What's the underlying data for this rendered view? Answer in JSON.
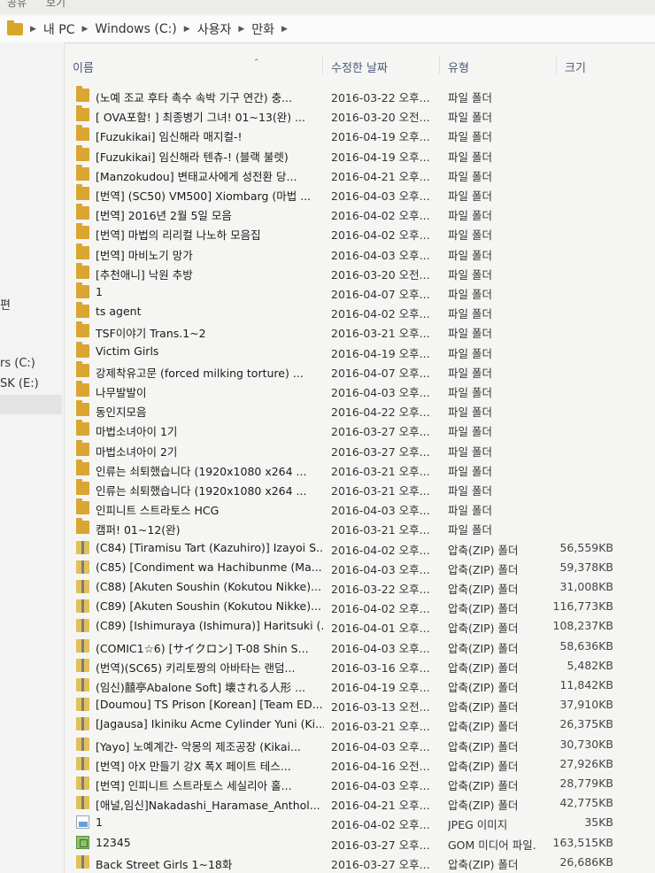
{
  "menu": {
    "items": [
      "공유",
      "보기"
    ]
  },
  "address": {
    "crumbs": [
      "내 PC",
      "Windows (C:)",
      "사용자",
      "만화"
    ]
  },
  "nav": {
    "partial_labels": [
      "편",
      "rs (C:)",
      "SK (E:)"
    ]
  },
  "columns": {
    "name": "이름",
    "date": "수정한 날짜",
    "type": "유형",
    "size": "크기"
  },
  "files": [
    {
      "icon": "folder",
      "name": "(노예 조교 후타 촉수 속박 기구 연간) 충...",
      "date": "2016-03-22 오후...",
      "type": "파일 폴더",
      "size": ""
    },
    {
      "icon": "folder",
      "name": "[ OVA포함! ] 최종병기 그녀! 01~13(완) ...",
      "date": "2016-03-20 오전...",
      "type": "파일 폴더",
      "size": ""
    },
    {
      "icon": "folder",
      "name": "[Fuzukikai] 임신해라 매지컬-!",
      "date": "2016-04-19 오후...",
      "type": "파일 폴더",
      "size": ""
    },
    {
      "icon": "folder",
      "name": "[Fuzukikai] 임신해라 텐츄-! (블랙 불렛)",
      "date": "2016-04-19 오후...",
      "type": "파일 폴더",
      "size": ""
    },
    {
      "icon": "folder",
      "name": "[Manzokudou] 변태교사에게 성전환 당...",
      "date": "2016-04-21 오후...",
      "type": "파일 폴더",
      "size": ""
    },
    {
      "icon": "folder",
      "name": "[번역] (SC50) VM500] Xiombarg (마법 ...",
      "date": "2016-04-03 오후...",
      "type": "파일 폴더",
      "size": ""
    },
    {
      "icon": "folder",
      "name": "[번역] 2016년 2월 5일 모음",
      "date": "2016-04-02 오후...",
      "type": "파일 폴더",
      "size": ""
    },
    {
      "icon": "folder",
      "name": "[번역] 마법의 리리컬 나노하 모음집",
      "date": "2016-04-02 오후...",
      "type": "파일 폴더",
      "size": ""
    },
    {
      "icon": "folder",
      "name": "[번역] 마비노기 망가",
      "date": "2016-04-03 오후...",
      "type": "파일 폴더",
      "size": ""
    },
    {
      "icon": "folder",
      "name": "[추천애니] 낙원 추방",
      "date": "2016-03-20 오전...",
      "type": "파일 폴더",
      "size": ""
    },
    {
      "icon": "folder",
      "name": "1",
      "date": "2016-04-07 오후...",
      "type": "파일 폴더",
      "size": ""
    },
    {
      "icon": "folder",
      "name": "ts agent",
      "date": "2016-04-02 오후...",
      "type": "파일 폴더",
      "size": ""
    },
    {
      "icon": "folder",
      "name": "TSF이야기 Trans.1~2",
      "date": "2016-03-21 오후...",
      "type": "파일 폴더",
      "size": ""
    },
    {
      "icon": "folder",
      "name": "Victim Girls",
      "date": "2016-04-19 오후...",
      "type": "파일 폴더",
      "size": ""
    },
    {
      "icon": "folder",
      "name": "강제착유고문 (forced milking torture) ...",
      "date": "2016-04-07 오후...",
      "type": "파일 폴더",
      "size": ""
    },
    {
      "icon": "folder",
      "name": "나무발발이",
      "date": "2016-04-03 오후...",
      "type": "파일 폴더",
      "size": ""
    },
    {
      "icon": "folder",
      "name": "동인지모음",
      "date": "2016-04-22 오후...",
      "type": "파일 폴더",
      "size": ""
    },
    {
      "icon": "folder",
      "name": "마법소녀아이 1기",
      "date": "2016-03-27 오후...",
      "type": "파일 폴더",
      "size": ""
    },
    {
      "icon": "folder",
      "name": "마법소녀아이 2기",
      "date": "2016-03-27 오후...",
      "type": "파일 폴더",
      "size": ""
    },
    {
      "icon": "folder",
      "name": "인류는 쇠퇴했습니다 (1920x1080 x264 ...",
      "date": "2016-03-21 오후...",
      "type": "파일 폴더",
      "size": ""
    },
    {
      "icon": "folder",
      "name": "인류는 쇠퇴했습니다 (1920x1080 x264 ...",
      "date": "2016-03-21 오후...",
      "type": "파일 폴더",
      "size": ""
    },
    {
      "icon": "folder",
      "name": "인피니트 스트라토스 HCG",
      "date": "2016-04-03 오후...",
      "type": "파일 폴더",
      "size": ""
    },
    {
      "icon": "folder",
      "name": "캠퍼! 01~12(완)",
      "date": "2016-03-21 오후...",
      "type": "파일 폴더",
      "size": ""
    },
    {
      "icon": "zip",
      "name": "(C84) [Tiramisu Tart (Kazuhiro)] Izayoi S...",
      "date": "2016-04-02 오후...",
      "type": "압축(ZIP) 폴더",
      "size": "56,559KB"
    },
    {
      "icon": "zip",
      "name": "(C85) [Condiment wa Hachibunme (Ma...",
      "date": "2016-04-03 오후...",
      "type": "압축(ZIP) 폴더",
      "size": "59,378KB"
    },
    {
      "icon": "zip",
      "name": "(C88) [Akuten Soushin (Kokutou Nikke)...",
      "date": "2016-03-22 오후...",
      "type": "압축(ZIP) 폴더",
      "size": "31,008KB"
    },
    {
      "icon": "zip",
      "name": "(C89) [Akuten Soushin (Kokutou Nikke)...",
      "date": "2016-04-02 오후...",
      "type": "압축(ZIP) 폴더",
      "size": "116,773KB"
    },
    {
      "icon": "zip",
      "name": "(C89) [Ishimuraya (Ishimura)] Haritsuki (...",
      "date": "2016-04-01 오후...",
      "type": "압축(ZIP) 폴더",
      "size": "108,237KB"
    },
    {
      "icon": "zip",
      "name": "(COMIC1☆6) [サイクロン] T-08 Shin S...",
      "date": "2016-04-03 오후...",
      "type": "압축(ZIP) 폴더",
      "size": "58,636KB"
    },
    {
      "icon": "zip",
      "name": "(번역)(SC65) 키리토짱의 아바타는 랜덤...",
      "date": "2016-03-16 오후...",
      "type": "압축(ZIP) 폴더",
      "size": "5,482KB"
    },
    {
      "icon": "zip",
      "name": "(임신)囍亭Abalone Soft] 壊される人形 ...",
      "date": "2016-04-19 오후...",
      "type": "압축(ZIP) 폴더",
      "size": "11,842KB"
    },
    {
      "icon": "zip",
      "name": "[Doumou] TS Prison [Korean] [Team ED...",
      "date": "2016-03-13 오전...",
      "type": "압축(ZIP) 폴더",
      "size": "37,910KB"
    },
    {
      "icon": "zip",
      "name": "[Jagausa] Ikiniku Acme Cylinder Yuni (Ki...",
      "date": "2016-03-21 오후...",
      "type": "압축(ZIP) 폴더",
      "size": "26,375KB"
    },
    {
      "icon": "zip",
      "name": "[Yayo] 노예계간- 악몽의 제조공장 (Kikai...",
      "date": "2016-04-03 오후...",
      "type": "압축(ZIP) 폴더",
      "size": "30,730KB"
    },
    {
      "icon": "zip",
      "name": "[번역] 아X 만들기 강X 폭X 페이트 테스...",
      "date": "2016-04-16 오전...",
      "type": "압축(ZIP) 폴더",
      "size": "27,926KB"
    },
    {
      "icon": "zip",
      "name": "[번역] 인피니트 스트라토스 세실리아 홀...",
      "date": "2016-04-03 오후...",
      "type": "압축(ZIP) 폴더",
      "size": "28,779KB"
    },
    {
      "icon": "zip",
      "name": "[애널,임신]Nakadashi_Haramase_Anthol...",
      "date": "2016-04-21 오후...",
      "type": "압축(ZIP) 폴더",
      "size": "42,775KB"
    },
    {
      "icon": "jpeg",
      "name": "1",
      "date": "2016-04-02 오후...",
      "type": "JPEG 이미지",
      "size": "35KB"
    },
    {
      "icon": "video",
      "name": "12345",
      "date": "2016-03-27 오후...",
      "type": "GOM 미디어 파일...",
      "size": "163,515KB"
    },
    {
      "icon": "zip",
      "name": "Back Street Girls 1~18화",
      "date": "2016-03-27 오후...",
      "type": "압축(ZIP) 폴더",
      "size": "26,686KB"
    }
  ]
}
